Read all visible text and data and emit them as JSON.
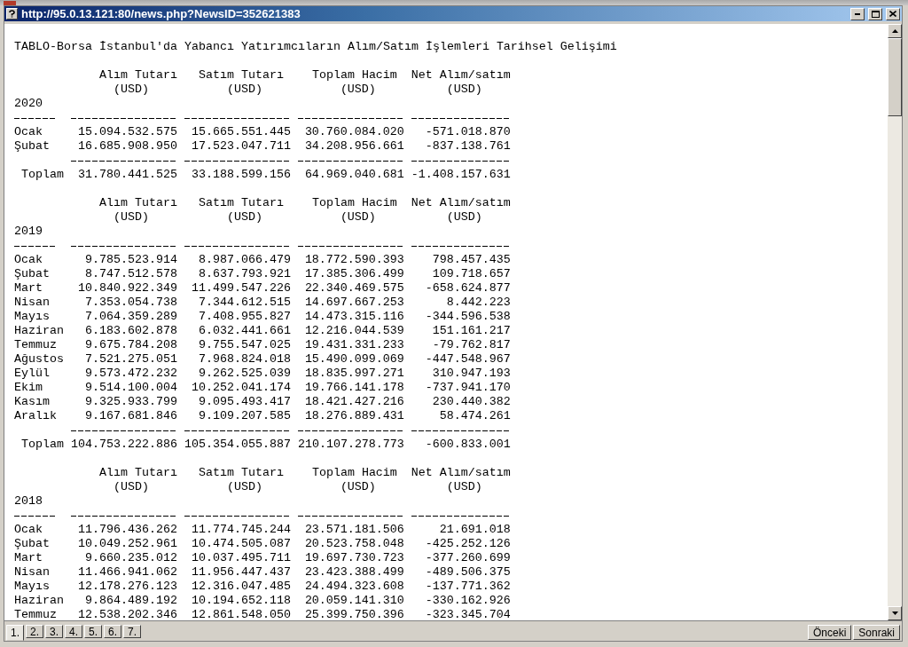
{
  "window": {
    "url": "http://95.0.13.121:80/news.php?NewsID=352621383"
  },
  "article": {
    "title": "TABLO-Borsa İstanbul'da Yabancı Yatırımcıların Alım/Satım İşlemleri Tarihsel Gelişimi",
    "sections": [
      {
        "year": "2020",
        "columns": [
          {
            "title": "Alım Tutarı",
            "unit": "(USD)"
          },
          {
            "title": "Satım Tutarı",
            "unit": "(USD)"
          },
          {
            "title": "Toplam Hacim",
            "unit": "(USD)"
          },
          {
            "title": "Net Alım/satım",
            "unit": "(USD)"
          }
        ],
        "rows": [
          {
            "month": "Ocak",
            "values": [
              "15.094.532.575",
              "15.665.551.445",
              "30.760.084.020",
              "-571.018.870"
            ]
          },
          {
            "month": "Şubat",
            "values": [
              "16.685.908.950",
              "17.523.047.711",
              "34.208.956.661",
              "-837.138.761"
            ]
          }
        ],
        "total": {
          "label": "Toplam",
          "values": [
            "31.780.441.525",
            "33.188.599.156",
            "64.969.040.681",
            "-1.408.157.631"
          ]
        }
      },
      {
        "year": "2019",
        "columns": [
          {
            "title": "Alım Tutarı",
            "unit": "(USD)"
          },
          {
            "title": "Satım Tutarı",
            "unit": "(USD)"
          },
          {
            "title": "Toplam Hacim",
            "unit": "(USD)"
          },
          {
            "title": "Net Alım/satım",
            "unit": "(USD)"
          }
        ],
        "rows": [
          {
            "month": "Ocak",
            "values": [
              "9.785.523.914",
              "8.987.066.479",
              "18.772.590.393",
              "798.457.435"
            ]
          },
          {
            "month": "Şubat",
            "values": [
              "8.747.512.578",
              "8.637.793.921",
              "17.385.306.499",
              "109.718.657"
            ]
          },
          {
            "month": "Mart",
            "values": [
              "10.840.922.349",
              "11.499.547.226",
              "22.340.469.575",
              "-658.624.877"
            ]
          },
          {
            "month": "Nisan",
            "values": [
              "7.353.054.738",
              "7.344.612.515",
              "14.697.667.253",
              "8.442.223"
            ]
          },
          {
            "month": "Mayıs",
            "values": [
              "7.064.359.289",
              "7.408.955.827",
              "14.473.315.116",
              "-344.596.538"
            ]
          },
          {
            "month": "Haziran",
            "values": [
              "6.183.602.878",
              "6.032.441.661",
              "12.216.044.539",
              "151.161.217"
            ]
          },
          {
            "month": "Temmuz",
            "values": [
              "9.675.784.208",
              "9.755.547.025",
              "19.431.331.233",
              "-79.762.817"
            ]
          },
          {
            "month": "Ağustos",
            "values": [
              "7.521.275.051",
              "7.968.824.018",
              "15.490.099.069",
              "-447.548.967"
            ]
          },
          {
            "month": "Eylül",
            "values": [
              "9.573.472.232",
              "9.262.525.039",
              "18.835.997.271",
              "310.947.193"
            ]
          },
          {
            "month": "Ekim",
            "values": [
              "9.514.100.004",
              "10.252.041.174",
              "19.766.141.178",
              "-737.941.170"
            ]
          },
          {
            "month": "Kasım",
            "values": [
              "9.325.933.799",
              "9.095.493.417",
              "18.421.427.216",
              "230.440.382"
            ]
          },
          {
            "month": "Aralık",
            "values": [
              "9.167.681.846",
              "9.109.207.585",
              "18.276.889.431",
              "58.474.261"
            ]
          }
        ],
        "total": {
          "label": "Toplam",
          "values": [
            "104.753.222.886",
            "105.354.055.887",
            "210.107.278.773",
            "-600.833.001"
          ]
        }
      },
      {
        "year": "2018",
        "columns": [
          {
            "title": "Alım Tutarı",
            "unit": "(USD)"
          },
          {
            "title": "Satım Tutarı",
            "unit": "(USD)"
          },
          {
            "title": "Toplam Hacim",
            "unit": "(USD)"
          },
          {
            "title": "Net Alım/satım",
            "unit": "(USD)"
          }
        ],
        "rows": [
          {
            "month": "Ocak",
            "values": [
              "11.796.436.262",
              "11.774.745.244",
              "23.571.181.506",
              "21.691.018"
            ]
          },
          {
            "month": "Şubat",
            "values": [
              "10.049.252.961",
              "10.474.505.087",
              "20.523.758.048",
              "-425.252.126"
            ]
          },
          {
            "month": "Mart",
            "values": [
              "9.660.235.012",
              "10.037.495.711",
              "19.697.730.723",
              "-377.260.699"
            ]
          },
          {
            "month": "Nisan",
            "values": [
              "11.466.941.062",
              "11.956.447.437",
              "23.423.388.499",
              "-489.506.375"
            ]
          },
          {
            "month": "Mayıs",
            "values": [
              "12.178.276.123",
              "12.316.047.485",
              "24.494.323.608",
              "-137.771.362"
            ]
          },
          {
            "month": "Haziran",
            "values": [
              "9.864.489.192",
              "10.194.652.118",
              "20.059.141.310",
              "-330.162.926"
            ]
          },
          {
            "month": "Temmuz",
            "values": [
              "12.538.202.346",
              "12.861.548.050",
              "25.399.750.396",
              "-323.345.704"
            ]
          }
        ]
      }
    ]
  },
  "pages": [
    {
      "label": "1.",
      "selected": true
    },
    {
      "label": "2.",
      "selected": false
    },
    {
      "label": "3.",
      "selected": false
    },
    {
      "label": "4.",
      "selected": false
    },
    {
      "label": "5.",
      "selected": false
    },
    {
      "label": "6.",
      "selected": false
    },
    {
      "label": "7.",
      "selected": false
    }
  ],
  "buttons": [
    "Önceki",
    "Sonraki"
  ]
}
